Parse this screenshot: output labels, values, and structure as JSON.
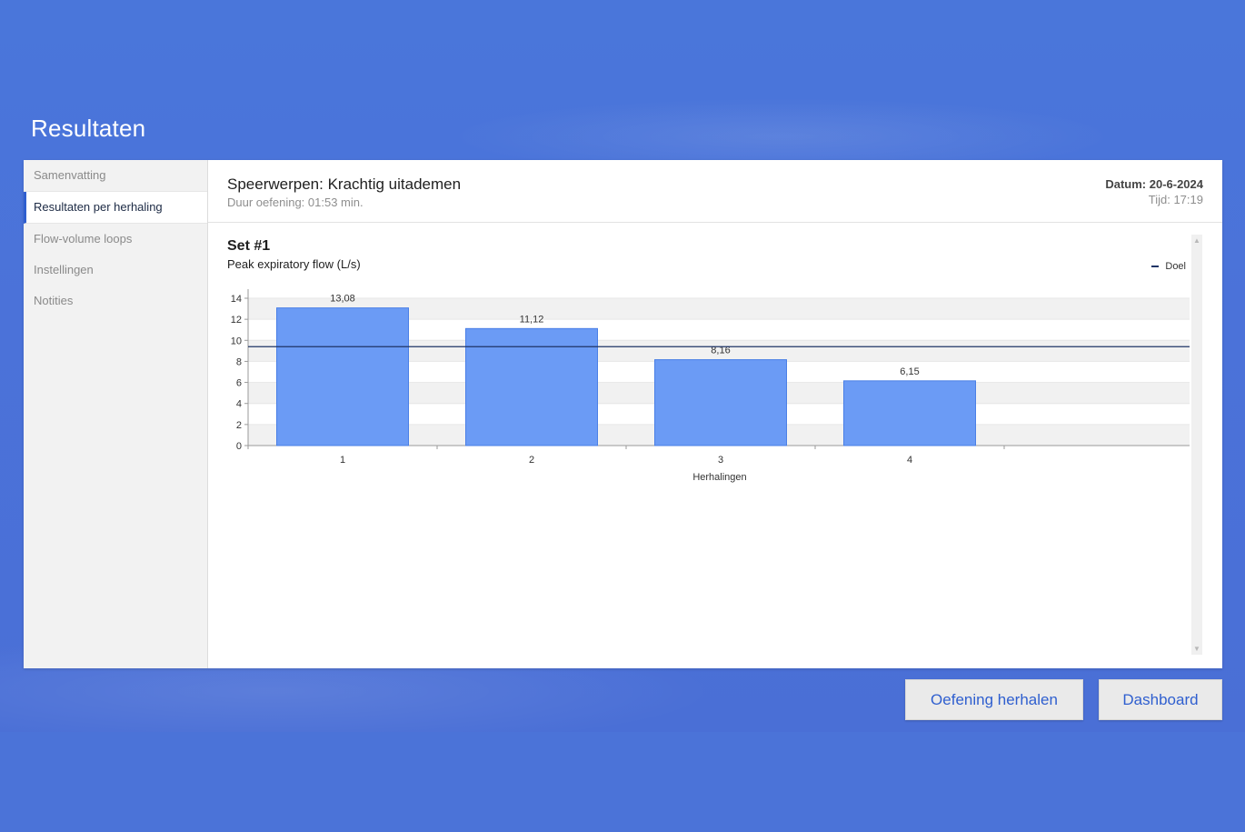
{
  "page": {
    "title": "Resultaten"
  },
  "sidebar": {
    "items": [
      {
        "label": "Samenvatting",
        "active": false
      },
      {
        "label": "Resultaten per herhaling",
        "active": true
      },
      {
        "label": "Flow-volume loops",
        "active": false
      },
      {
        "label": "Instellingen",
        "active": false
      },
      {
        "label": "Notities",
        "active": false
      }
    ]
  },
  "exercise": {
    "title": "Speerwerpen: Krachtig uitademen",
    "duration": "Duur oefening: 01:53 min.",
    "date": "Datum: 20-6-2024",
    "time": "Tijd: 17:19"
  },
  "set": {
    "title": "Set #1",
    "subtitle": "Peak expiratory flow (L/s)"
  },
  "chart_data": {
    "type": "bar",
    "categories": [
      "1",
      "2",
      "3",
      "4"
    ],
    "values": [
      13.08,
      11.12,
      8.16,
      6.15
    ],
    "value_labels": [
      "13,08",
      "11,12",
      "8,16",
      "6,15"
    ],
    "target": 9.4,
    "target_label": "Doel",
    "xlabel": "Herhalingen",
    "ylabel": "",
    "ylim": [
      0,
      14
    ],
    "yticks": [
      0,
      2,
      4,
      6,
      8,
      10,
      12,
      14
    ],
    "grid": "horizontal bands",
    "legend": "top-right",
    "bar_color": "#6b9bf5",
    "bar_border": "#4a7fe6",
    "target_color": "#1f3466"
  },
  "buttons": {
    "repeat": "Oefening herhalen",
    "dashboard": "Dashboard"
  },
  "colors": {
    "background": "#4a74d8",
    "accent": "#2f5fcf"
  }
}
